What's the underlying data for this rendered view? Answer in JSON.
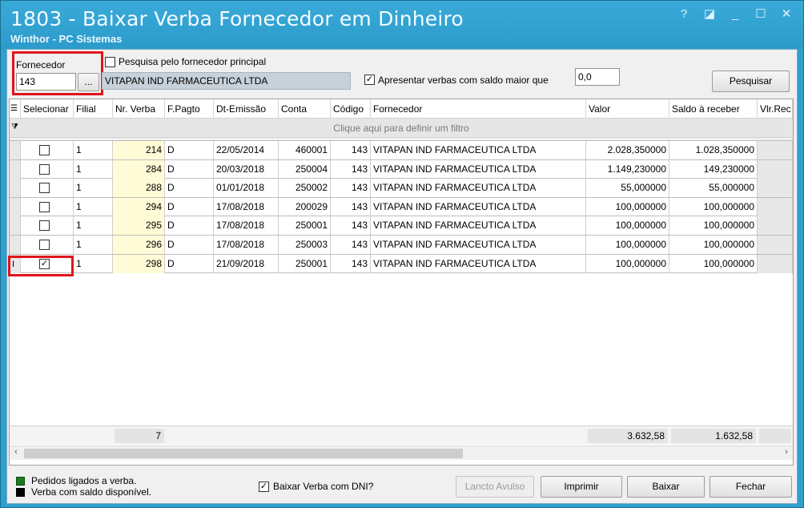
{
  "window": {
    "title": "1803 - Baixar Verba Fornecedor em Dinheiro",
    "subtitle": "Winthor - PC Sistemas",
    "controls": [
      "?",
      "◪",
      "_",
      "☐",
      "✕"
    ]
  },
  "filters": {
    "fornecedor_label": "Fornecedor",
    "fornecedor_value": "143",
    "browse_label": "...",
    "fornecedor_name": "VITAPAN IND FARMACEUTICA LTDA",
    "pesquisa_principal_label": "Pesquisa pelo fornecedor principal",
    "pesquisa_principal_checked": false,
    "apresentar_label": "Apresentar verbas com saldo maior que",
    "apresentar_checked": true,
    "saldo_value": "0,0",
    "pesquisar_label": "Pesquisar"
  },
  "grid": {
    "headers": [
      "Selecionar",
      "Filial",
      "Nr. Verba",
      "F.Pagto",
      "Dt-Emissão",
      "Conta",
      "Código",
      "Fornecedor",
      "Valor",
      "Saldo à receber",
      "Vlr.Rec"
    ],
    "filter_hint": "Clique aqui para definir um filtro",
    "rows": [
      {
        "selected": false,
        "filial": "1",
        "nr_verba": "214",
        "fpagto": "D",
        "dt_emissao": "22/05/2014",
        "conta": "460001",
        "codigo": "143",
        "fornecedor": "VITAPAN IND FARMACEUTICA LTDA",
        "valor": "2.028,350000",
        "saldo": "1.028,350000"
      },
      {
        "selected": false,
        "filial": "1",
        "nr_verba": "284",
        "fpagto": "D",
        "dt_emissao": "20/03/2018",
        "conta": "250004",
        "codigo": "143",
        "fornecedor": "VITAPAN IND FARMACEUTICA LTDA",
        "valor": "1.149,230000",
        "saldo": "149,230000"
      },
      {
        "selected": false,
        "filial": "1",
        "nr_verba": "288",
        "fpagto": "D",
        "dt_emissao": "01/01/2018",
        "conta": "250002",
        "codigo": "143",
        "fornecedor": "VITAPAN IND FARMACEUTICA LTDA",
        "valor": "55,000000",
        "saldo": "55,000000"
      },
      {
        "selected": false,
        "filial": "1",
        "nr_verba": "294",
        "fpagto": "D",
        "dt_emissao": "17/08/2018",
        "conta": "200029",
        "codigo": "143",
        "fornecedor": "VITAPAN IND FARMACEUTICA LTDA",
        "valor": "100,000000",
        "saldo": "100,000000"
      },
      {
        "selected": false,
        "filial": "1",
        "nr_verba": "295",
        "fpagto": "D",
        "dt_emissao": "17/08/2018",
        "conta": "250001",
        "codigo": "143",
        "fornecedor": "VITAPAN IND FARMACEUTICA LTDA",
        "valor": "100,000000",
        "saldo": "100,000000"
      },
      {
        "selected": false,
        "filial": "1",
        "nr_verba": "296",
        "fpagto": "D",
        "dt_emissao": "17/08/2018",
        "conta": "250003",
        "codigo": "143",
        "fornecedor": "VITAPAN IND FARMACEUTICA LTDA",
        "valor": "100,000000",
        "saldo": "100,000000"
      },
      {
        "selected": true,
        "filial": "1",
        "nr_verba": "298",
        "fpagto": "D",
        "dt_emissao": "21/09/2018",
        "conta": "250001",
        "codigo": "143",
        "fornecedor": "VITAPAN IND FARMACEUTICA LTDA",
        "valor": "100,000000",
        "saldo": "100,000000"
      }
    ],
    "totals": {
      "count": "7",
      "valor": "3.632,58",
      "saldo": "1.632,58"
    }
  },
  "legend": {
    "items": [
      {
        "label": "Pedidos ligados a verba.",
        "color": "#1e7a1e"
      },
      {
        "label": "Verba com saldo disponível.",
        "color": "#000000"
      }
    ]
  },
  "bottom": {
    "dni_label": "Baixar Verba com DNI?",
    "dni_checked": true,
    "lancto_label": "Lancto Avulso",
    "imprimir_label": "Imprimir",
    "baixar_label": "Baixar",
    "fechar_label": "Fechar"
  },
  "colors": {
    "titlebar": "#2fa0cf",
    "highlight": "#e0141c",
    "verba_cell": "#fffbd6"
  }
}
